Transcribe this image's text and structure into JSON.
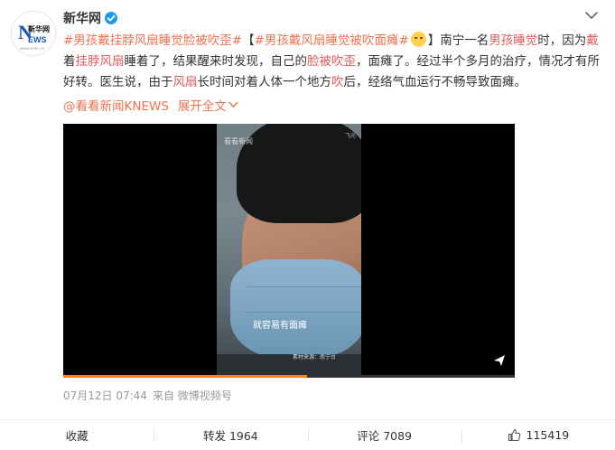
{
  "account": {
    "name": "新华网",
    "avatar_logo": {
      "letter": "N",
      "cn": "新华网",
      "ews": "EWS",
      "url": "www.news.cn"
    }
  },
  "post": {
    "topic1": "#男孩戴挂脖风扇睡觉脸被吹歪#",
    "bracket_open": "【",
    "topic2_a": "#男孩戴风扇睡觉被吹",
    "topic2_b": "面瘫",
    "topic2_c": "#",
    "bracket_close": "】",
    "seg1": "南宁一名",
    "hl1": "男孩睡觉",
    "seg2": "时，因为",
    "hl2": "戴",
    "seg3": "着",
    "hl3": "挂脖风扇",
    "seg4": "睡着了，结果醒来时发现，自己的",
    "hl4": "脸被吹歪",
    "seg5": "，面瘫了。经过半个多月的治疗，情况才有所好转。医生说，由于",
    "hl5": "风扇",
    "seg6": "长时间对着人体一个地方",
    "hl6": "吹",
    "seg7": "后，经络气血运行不畅导致面瘫。",
    "source": "@看看新闻KNEWS",
    "expand": "展开全文"
  },
  "video": {
    "watermark": "看看新闻",
    "watermark2": "飞光",
    "subtitle": "就容易有面瘫",
    "credit": "素材来源：南宁台",
    "progress": 0.54
  },
  "meta": {
    "time": "07月12日 07:44",
    "from": "来自 微博视频号"
  },
  "actions": {
    "favorite": "收藏",
    "repost": "转发 1964",
    "comment": "评论 7089",
    "like": "115419"
  },
  "colors": {
    "topic": "#eb7350",
    "highlight": "#e05a5a",
    "progress": "#ff8200"
  }
}
